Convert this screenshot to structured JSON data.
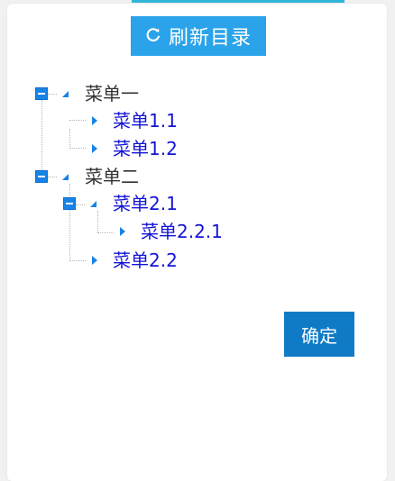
{
  "toolbar": {
    "refresh_label": "刷新目录",
    "refresh_icon": "refresh-icon"
  },
  "tree": {
    "items": [
      {
        "label": "菜单一",
        "level": 0,
        "expanded": true
      },
      {
        "label": "菜单1.1",
        "level": 1
      },
      {
        "label": "菜单1.2",
        "level": 1
      },
      {
        "label": "菜单二",
        "level": 0,
        "expanded": true
      },
      {
        "label": "菜单2.1",
        "level": 1,
        "expanded": true
      },
      {
        "label": "菜单2.2.1",
        "level": 2
      },
      {
        "label": "菜单2.2",
        "level": 1
      }
    ]
  },
  "footer": {
    "confirm_label": "确定"
  },
  "colors": {
    "accent": "#2aa3ea",
    "confirm": "#0f7bc6",
    "tree_icon": "#1683e6",
    "leaf_text": "#1414d6",
    "parent_text": "#333333"
  }
}
